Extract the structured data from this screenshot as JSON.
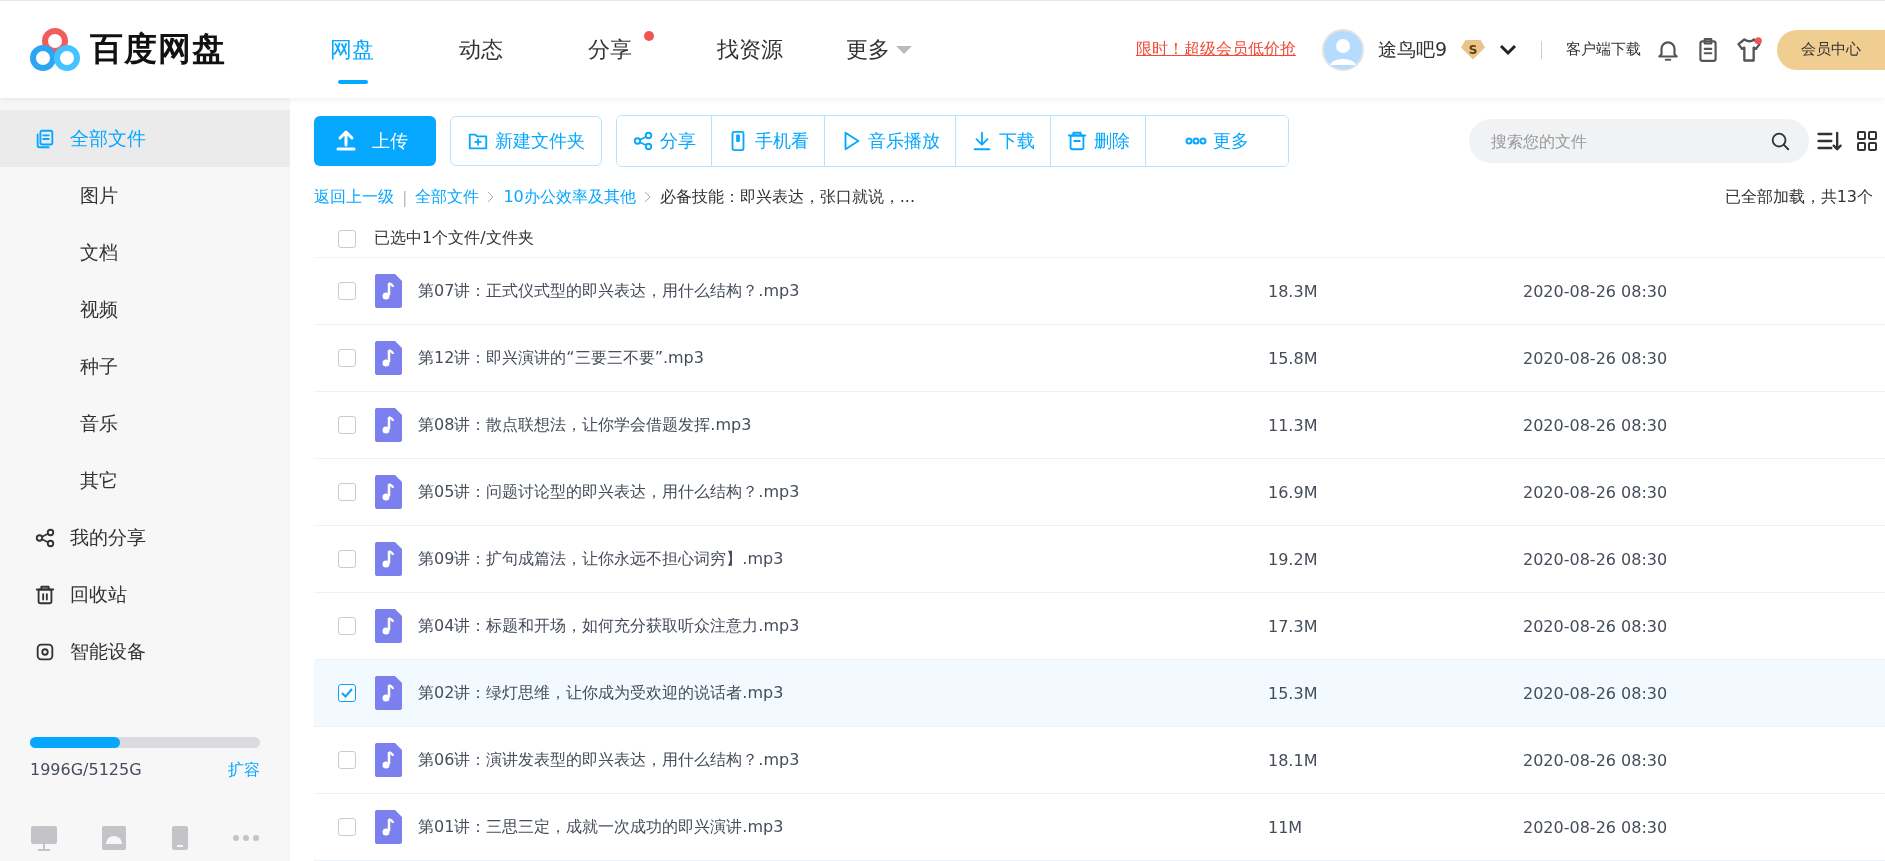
{
  "logo": {
    "text": "百度网盘"
  },
  "nav": [
    {
      "label": "网盘",
      "selected": true,
      "dot": false,
      "caret": false
    },
    {
      "label": "动态",
      "selected": false,
      "dot": false,
      "caret": false
    },
    {
      "label": "分享",
      "selected": false,
      "dot": true,
      "caret": false
    },
    {
      "label": "找资源",
      "selected": false,
      "dot": false,
      "caret": false
    },
    {
      "label": "更多",
      "selected": false,
      "dot": false,
      "caret": true
    }
  ],
  "promo": "限时！超级会员低价抢",
  "user": {
    "name": "途鸟吧9",
    "badge": "S"
  },
  "client_download": "客户端下载",
  "vip_center": "会员中心",
  "sidebar": {
    "items": [
      {
        "label": "全部文件",
        "selected": true,
        "kind": "section"
      },
      {
        "label": "图片",
        "selected": false,
        "kind": "sub"
      },
      {
        "label": "文档",
        "selected": false,
        "kind": "sub"
      },
      {
        "label": "视频",
        "selected": false,
        "kind": "sub"
      },
      {
        "label": "种子",
        "selected": false,
        "kind": "sub"
      },
      {
        "label": "音乐",
        "selected": false,
        "kind": "sub"
      },
      {
        "label": "其它",
        "selected": false,
        "kind": "sub"
      },
      {
        "label": "我的分享",
        "selected": false,
        "kind": "section"
      },
      {
        "label": "回收站",
        "selected": false,
        "kind": "section"
      },
      {
        "label": "智能设备",
        "selected": false,
        "kind": "section"
      }
    ],
    "storage": {
      "level": 0.39,
      "text": "1996G/5125G",
      "expand": "扩容"
    }
  },
  "toolbar": {
    "upload": "上传",
    "new_folder": "新建文件夹",
    "actions": [
      {
        "label": "分享"
      },
      {
        "label": "手机看"
      },
      {
        "label": "音乐播放"
      },
      {
        "label": "下载"
      },
      {
        "label": "删除"
      },
      {
        "label": "更多"
      }
    ],
    "search": {
      "placeholder": "搜索您的文件"
    }
  },
  "breadcrumb": {
    "back": "返回上一级",
    "sep": "|",
    "items": [
      "全部文件",
      "10办公效率及其他"
    ],
    "current": "必备技能：即兴表达，张口就说，...",
    "status": "已全部加载，共13个"
  },
  "selection": {
    "checked": false,
    "text": "已选中1个文件/文件夹"
  },
  "files": [
    {
      "name": "第07讲：正式仪式型的即兴表达，用什么结构？.mp3",
      "size": "18.3M",
      "date": "2020-08-26 08:30",
      "selected": false
    },
    {
      "name": "第12讲：即兴演讲的“三要三不要”.mp3",
      "size": "15.8M",
      "date": "2020-08-26 08:30",
      "selected": false
    },
    {
      "name": "第08讲：散点联想法，让你学会借题发挥.mp3",
      "size": "11.3M",
      "date": "2020-08-26 08:30",
      "selected": false
    },
    {
      "name": "第05讲：问题讨论型的即兴表达，用什么结构？.mp3",
      "size": "16.9M",
      "date": "2020-08-26 08:30",
      "selected": false
    },
    {
      "name": "第09讲：扩句成篇法，让你永远不担心词穷】.mp3",
      "size": "19.2M",
      "date": "2020-08-26 08:30",
      "selected": false
    },
    {
      "name": "第04讲：标题和开场，如何充分获取听众注意力.mp3",
      "size": "17.3M",
      "date": "2020-08-26 08:30",
      "selected": false
    },
    {
      "name": "第02讲：绿灯思维，让你成为受欢迎的说话者.mp3",
      "size": "15.3M",
      "date": "2020-08-26 08:30",
      "selected": true
    },
    {
      "name": "第06讲：演讲发表型的即兴表达，用什么结构？.mp3",
      "size": "18.1M",
      "date": "2020-08-26 08:30",
      "selected": false
    },
    {
      "name": "第01讲：三思三定，成就一次成功的即兴演讲.mp3",
      "size": "11M",
      "date": "2020-08-26 08:30",
      "selected": false
    }
  ]
}
